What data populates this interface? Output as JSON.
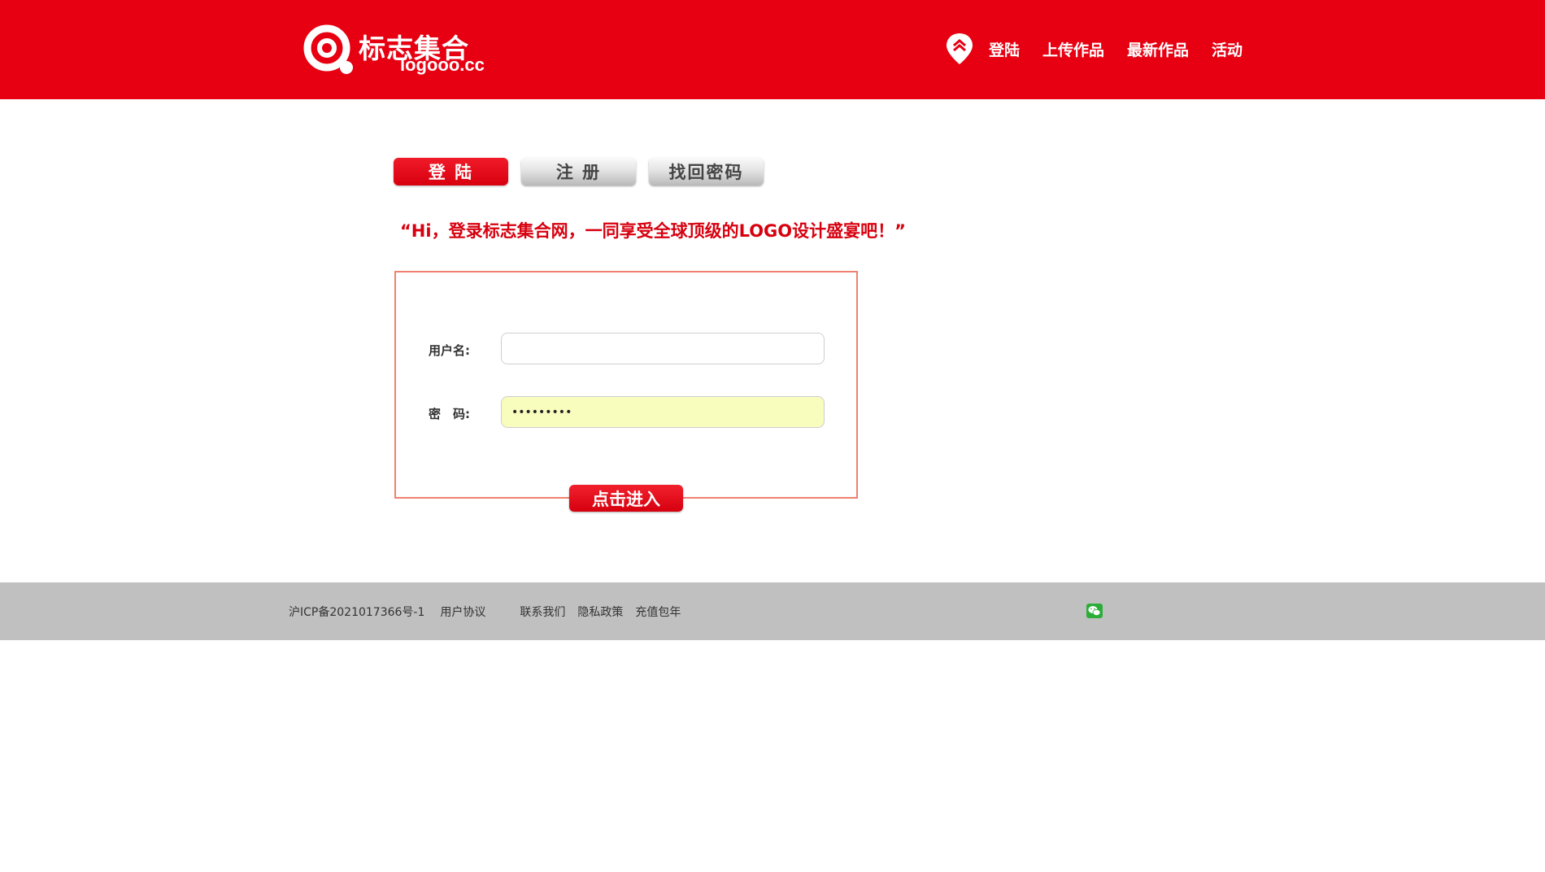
{
  "header": {
    "logo_cn": "标志集合",
    "logo_en": "logooo.cc",
    "nav": {
      "icon": "location-pin-up-icon",
      "items": [
        "登陆",
        "上传作品",
        "最新作品",
        "活动"
      ]
    }
  },
  "tabs": [
    {
      "label": "登 陆",
      "active": true
    },
    {
      "label": "注 册",
      "active": false
    },
    {
      "label": "找回密码",
      "active": false
    }
  ],
  "slogan": "“Hi，登录标志集合网，一同享受全球顶级的LOGO设计盛宴吧！”",
  "form": {
    "username_label": "用户名:",
    "username_value": "",
    "password_label": "密　码:",
    "password_value": "•••••••••",
    "submit_label": "点击进入"
  },
  "footer": {
    "icp": "沪ICP备2021017366号-1",
    "links": [
      "用户协议",
      "联系我们",
      "隐私政策",
      "充值包年"
    ],
    "social_icon": "wechat-icon"
  },
  "colors": {
    "brand_red": "#e60012",
    "footer_gray": "#c0c0c0",
    "autofill_yellow": "#f8fcbc"
  }
}
